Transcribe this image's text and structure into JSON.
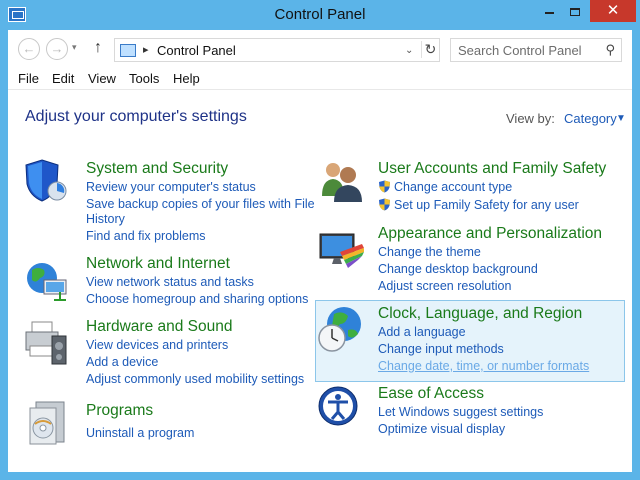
{
  "window": {
    "title": "Control Panel"
  },
  "address": {
    "path": "Control Panel"
  },
  "search": {
    "placeholder": "Search Control Panel"
  },
  "menu": [
    "File",
    "Edit",
    "View",
    "Tools",
    "Help"
  ],
  "header": {
    "title": "Adjust your computer's settings",
    "view_by_label": "View by:",
    "view_by_value": "Category"
  },
  "categories": [
    {
      "title": "System and Security",
      "links": [
        "Review your computer's status",
        "Save backup copies of your files with File",
        "History",
        "Find and fix problems"
      ]
    },
    {
      "title": "Network and Internet",
      "links": [
        "View network status and tasks",
        "Choose homegroup and sharing options"
      ]
    },
    {
      "title": "Hardware and Sound",
      "links": [
        "View devices and printers",
        "Add a device",
        "Adjust commonly used mobility settings"
      ]
    },
    {
      "title": "Programs",
      "links": [
        "Uninstall a program"
      ]
    },
    {
      "title": "User Accounts and Family Safety",
      "links": [
        "Change account type",
        "Set up Family Safety for any user"
      ]
    },
    {
      "title": "Appearance and Personalization",
      "links": [
        "Change the theme",
        "Change desktop background",
        "Adjust screen resolution"
      ]
    },
    {
      "title": "Clock, Language, and Region",
      "links": [
        "Add a language",
        "Change input methods",
        "Change date, time, or number formats"
      ]
    },
    {
      "title": "Ease of Access",
      "links": [
        "Let Windows suggest settings",
        "Optimize visual display"
      ]
    }
  ],
  "colors": {
    "frame": "#5bb4e8",
    "group_title": "#1a7a1a",
    "link": "#1e5bb8",
    "page_title": "#1e3287",
    "close_button": "#c7382b",
    "highlight": "#e5f3fb"
  }
}
